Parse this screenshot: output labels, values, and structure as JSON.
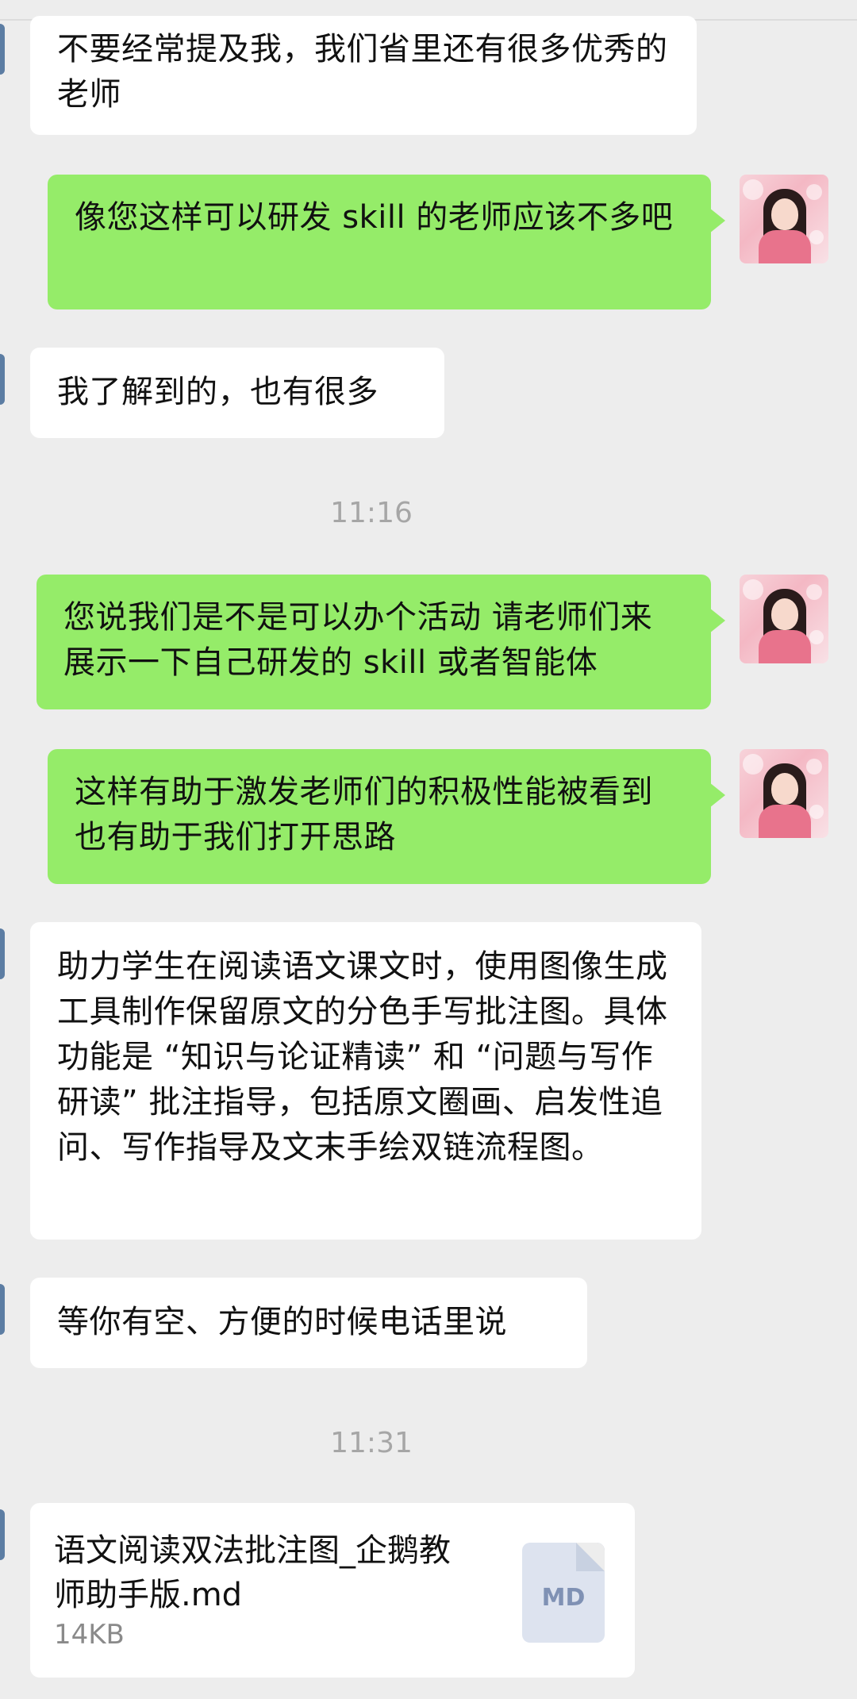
{
  "messages": [
    {
      "side": "in",
      "text": "不要经常提及我，我们省里还有很多优秀的老师"
    },
    {
      "side": "out",
      "text": "像您这样可以研发 skill 的老师应该不多吧"
    },
    {
      "side": "in",
      "text": "我了解到的，也有很多"
    },
    {
      "timestamp": "11:16"
    },
    {
      "side": "out",
      "text": "您说我们是不是可以办个活动 请老师们来展示一下自己研发的 skill 或者智能体"
    },
    {
      "side": "out",
      "text": "这样有助于激发老师们的积极性能被看到也有助于我们打开思路"
    },
    {
      "side": "in",
      "text": "助力学生在阅读语文课文时，使用图像生成工具制作保留原文的分色手写批注图。具体功能是 “知识与论证精读” 和 “问题与写作研读” 批注指导，包括原文圈画、启发性追问、写作指导及文末手绘双链流程图。"
    },
    {
      "side": "in",
      "text": "等你有空、方便的时候电话里说"
    },
    {
      "timestamp": "11:31"
    }
  ],
  "file": {
    "name": "语文阅读双法批注图_企鹅教师助手版.md",
    "size": "14KB",
    "ext": "MD",
    "icon": "document-icon"
  },
  "colors": {
    "background": "#ededed",
    "incoming_bubble": "#ffffff",
    "outgoing_bubble": "#95ec69"
  }
}
